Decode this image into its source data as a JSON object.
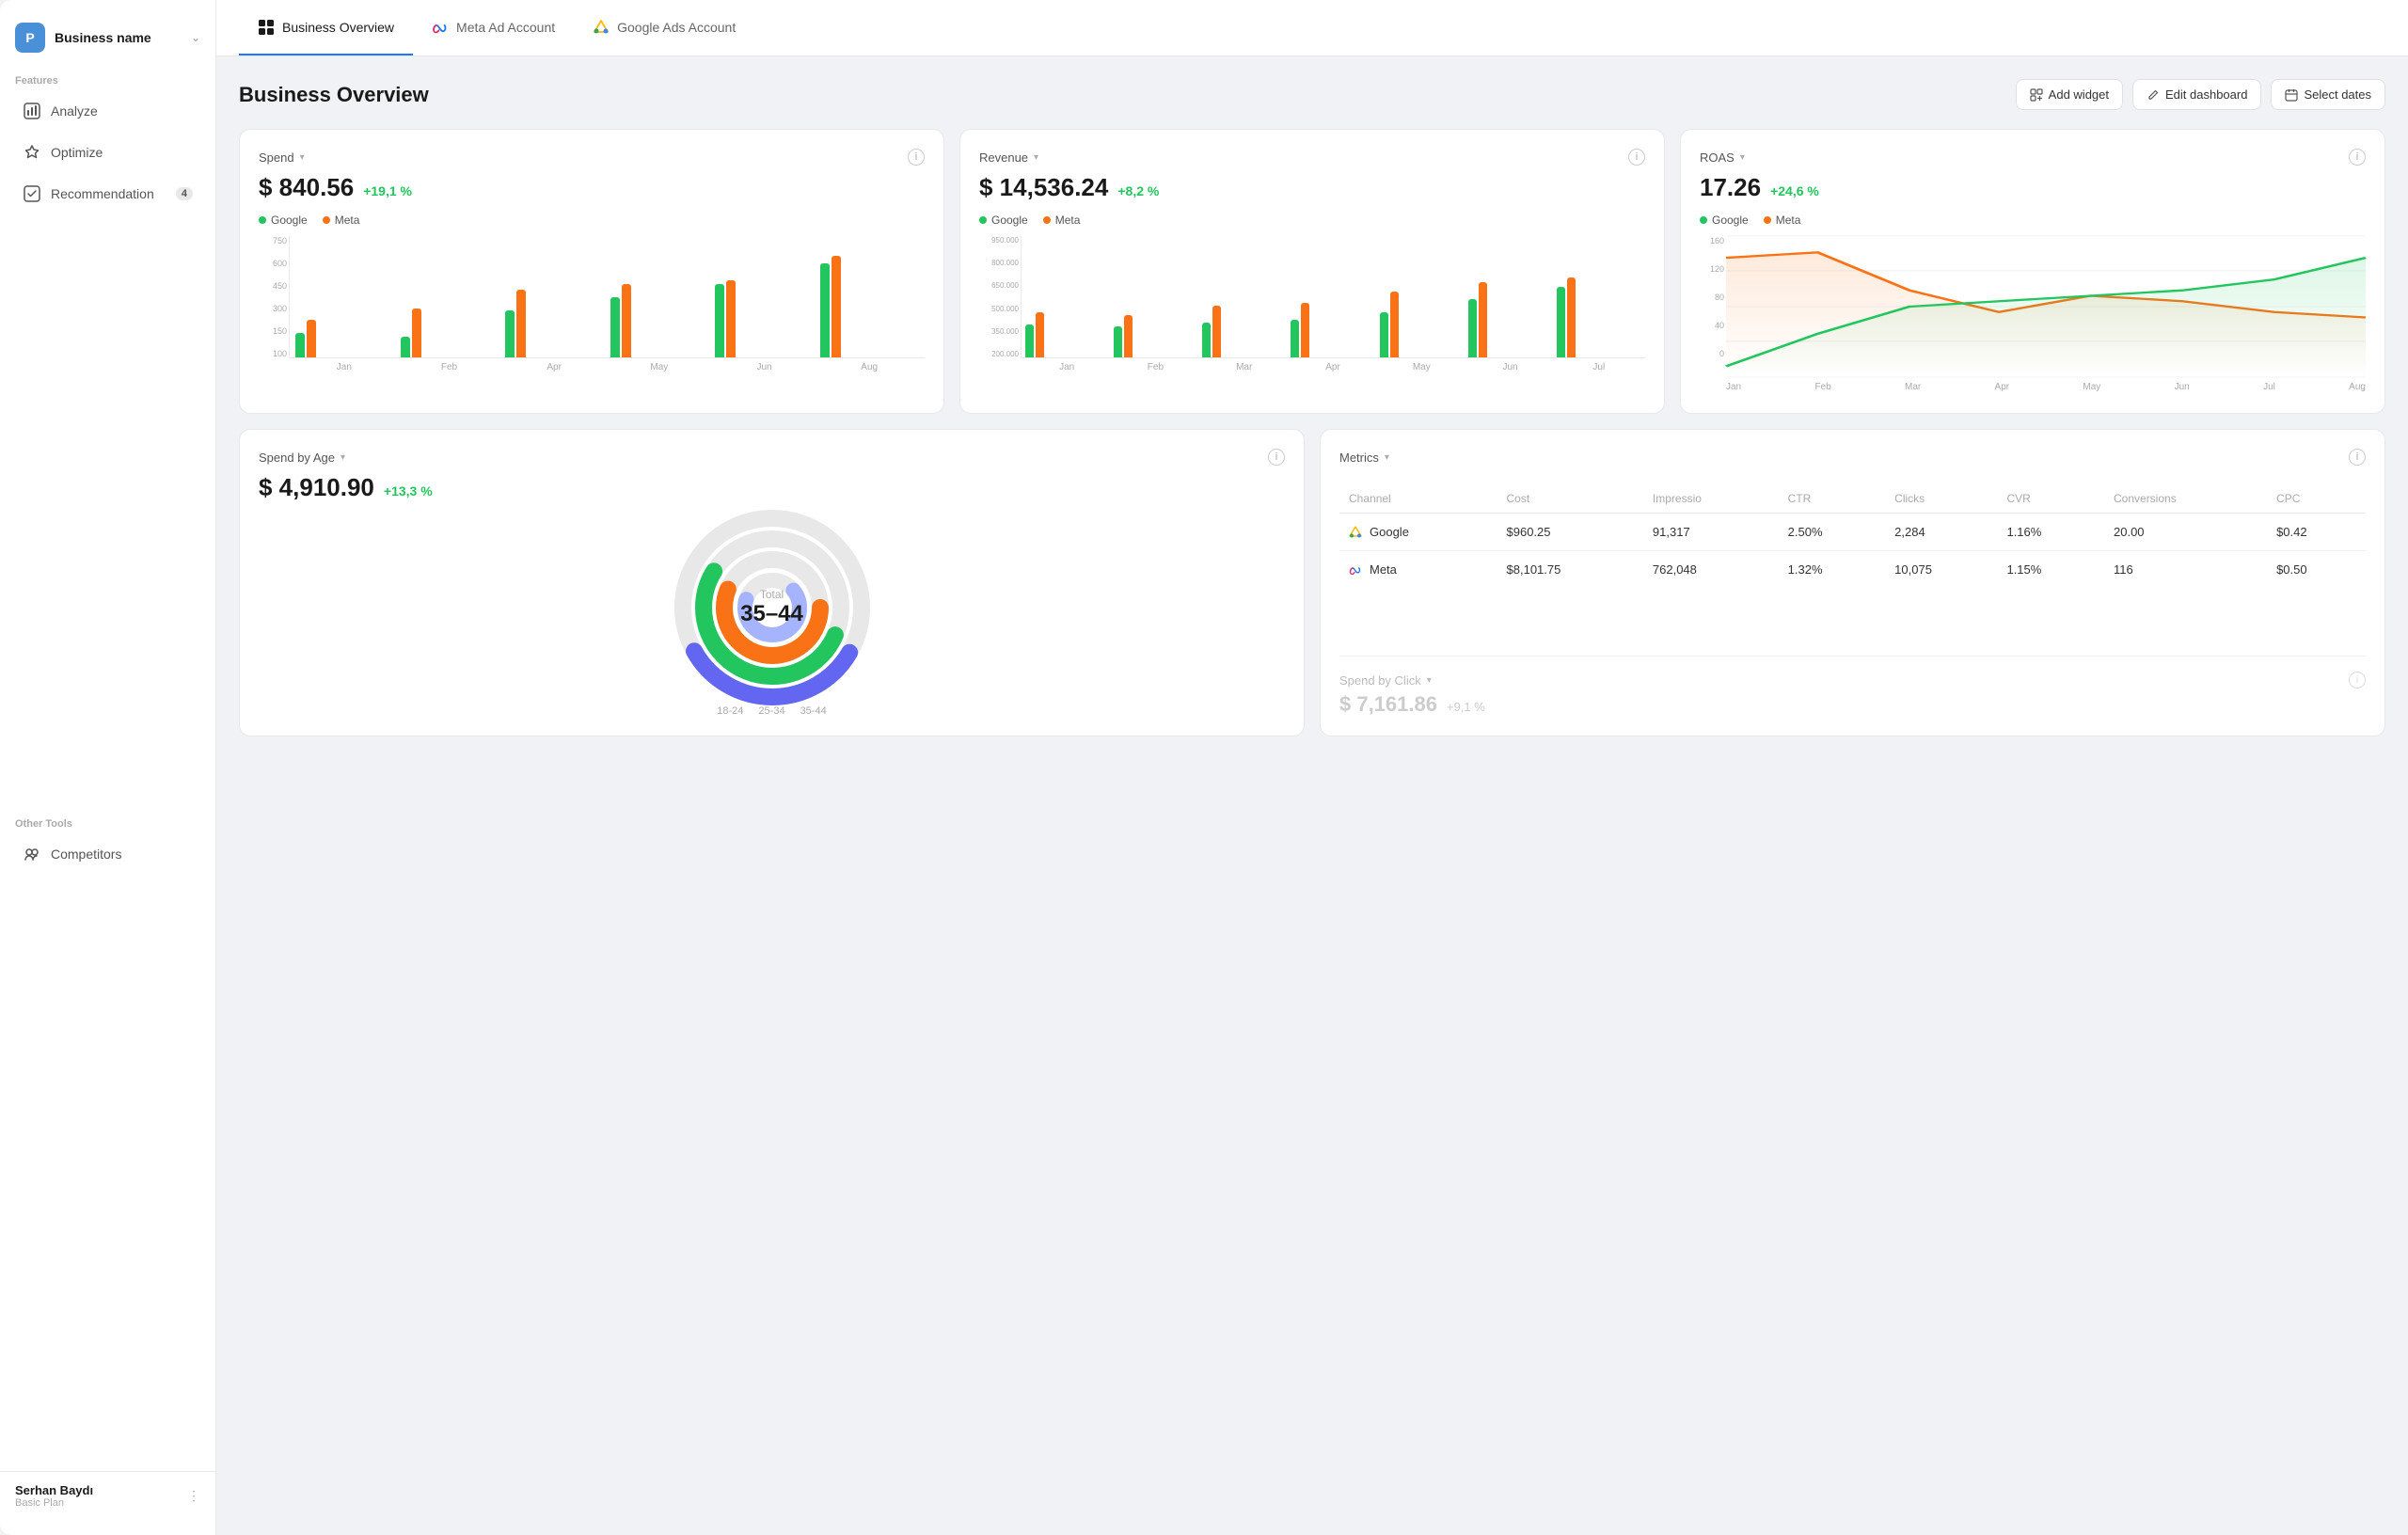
{
  "sidebar": {
    "business_avatar": "P",
    "business_name": "Business name",
    "features_label": "Features",
    "items": [
      {
        "id": "analyze",
        "label": "Analyze",
        "icon": "analyze"
      },
      {
        "id": "optimize",
        "label": "Optimize",
        "icon": "optimize"
      },
      {
        "id": "recommendation",
        "label": "Recommendation",
        "icon": "recommendation",
        "badge": "4"
      }
    ],
    "other_tools_label": "Other Tools",
    "other_tools": [
      {
        "id": "competitors",
        "label": "Competitors",
        "icon": "competitors"
      }
    ],
    "user": {
      "name": "Serhan Baydı",
      "plan": "Basic Plan"
    }
  },
  "top_nav": {
    "tabs": [
      {
        "id": "business-overview",
        "label": "Business Overview",
        "icon": "grid",
        "active": true
      },
      {
        "id": "meta-ad-account",
        "label": "Meta Ad Account",
        "icon": "meta",
        "active": false
      },
      {
        "id": "google-ads-account",
        "label": "Google Ads Account",
        "icon": "google-ads",
        "active": false
      }
    ]
  },
  "header": {
    "title": "Business Overview",
    "actions": {
      "add_widget": "Add widget",
      "edit_dashboard": "Edit dashboard",
      "select_dates": "Select dates"
    }
  },
  "widgets": {
    "spend": {
      "title": "Spend",
      "value": "$ 840.56",
      "change": "+19,1 %",
      "google_label": "Google",
      "meta_label": "Meta",
      "y_labels": [
        "750",
        "600",
        "450",
        "300",
        "150",
        "100"
      ],
      "x_labels": [
        "Jan",
        "Feb",
        "Apr",
        "May",
        "Jun",
        "Aug"
      ],
      "bars": [
        {
          "google": 30,
          "meta": 45
        },
        {
          "google": 28,
          "meta": 58
        },
        {
          "google": 55,
          "meta": 80
        },
        {
          "google": 70,
          "meta": 85
        },
        {
          "google": 85,
          "meta": 90
        },
        {
          "google": 110,
          "meta": 118
        }
      ]
    },
    "revenue": {
      "title": "Revenue",
      "value": "$ 14,536.24",
      "change": "+8,2 %",
      "google_label": "Google",
      "meta_label": "Meta",
      "y_labels": [
        "950.000",
        "800.000",
        "650.000",
        "500.000",
        "350.000",
        "200.000"
      ],
      "x_labels": [
        "Jan",
        "Feb",
        "Mar",
        "Apr",
        "May",
        "Jun",
        "Jul"
      ],
      "bars": [
        {
          "google": 40,
          "meta": 55
        },
        {
          "google": 38,
          "meta": 52
        },
        {
          "google": 42,
          "meta": 60
        },
        {
          "google": 45,
          "meta": 65
        },
        {
          "google": 55,
          "meta": 78
        },
        {
          "google": 70,
          "meta": 90
        },
        {
          "google": 85,
          "meta": 95
        }
      ]
    },
    "roas": {
      "title": "ROAS",
      "value": "17.26",
      "change": "+24,6 %",
      "google_label": "Google",
      "meta_label": "Meta",
      "x_labels": [
        "Jan",
        "Feb",
        "Mar",
        "Apr",
        "May",
        "Jun",
        "Jul",
        "Aug"
      ],
      "y_labels": [
        "160",
        "120",
        "80",
        "40",
        "0"
      ]
    },
    "spend_by_age": {
      "title": "Spend by Age",
      "value": "$ 4,910.90",
      "change": "+13,3 %",
      "center_label": "Total",
      "center_value": "35–44",
      "age_labels": [
        "18-24",
        "25-34",
        "35-44"
      ],
      "segments": [
        {
          "color": "#f97316",
          "percent": 30
        },
        {
          "color": "#22c55e",
          "percent": 25
        },
        {
          "color": "#6366f1",
          "percent": 25
        },
        {
          "color": "#a5b4fc",
          "percent": 20
        }
      ]
    },
    "metrics": {
      "title": "Metrics",
      "columns": [
        "Channel",
        "Cost",
        "Impressio",
        "CTR",
        "Clicks",
        "CVR",
        "Conversions",
        "CPC"
      ],
      "rows": [
        {
          "channel": "Google",
          "channel_icon": "google",
          "cost": "$960.25",
          "impressions": "91,317",
          "ctr": "2.50%",
          "clicks": "2,284",
          "cvr": "1.16%",
          "conversions": "20.00",
          "cpc": "$0.42"
        },
        {
          "channel": "Meta",
          "channel_icon": "meta",
          "cost": "$8,101.75",
          "impressions": "762,048",
          "ctr": "1.32%",
          "clicks": "10,075",
          "cvr": "1.15%",
          "conversions": "116",
          "cpc": "$0.50"
        }
      ]
    },
    "spend_by_click": {
      "title": "Spend by Click",
      "value": "$ 7,161.86",
      "change": "+9,1 %"
    }
  },
  "colors": {
    "green": "#22c55e",
    "orange": "#f97316",
    "blue": "#6366f1",
    "light_blue": "#a5b4fc",
    "accent": "#1a7aff"
  }
}
